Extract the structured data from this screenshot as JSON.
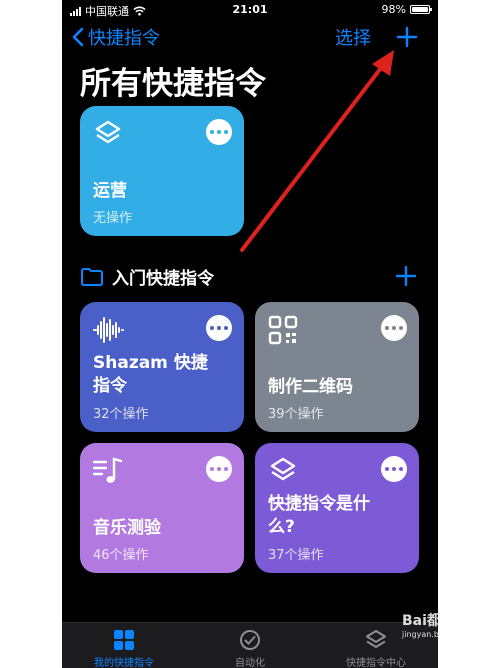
{
  "status_bar": {
    "carrier": "中国联通",
    "time": "21:01",
    "battery": "98%",
    "battery_level": 0.98
  },
  "nav": {
    "back_label": "快捷指令",
    "select_label": "选择"
  },
  "page_title": "所有快捷指令",
  "shortcuts_top": [
    {
      "name": "运营",
      "subtitle": "无操作",
      "icon": "layers-icon",
      "color": "#32ade6"
    }
  ],
  "section": {
    "title": "入门快捷指令",
    "icon": "folder-icon"
  },
  "starter_shortcuts": [
    {
      "name": "Shazam 快捷\n指令",
      "subtitle": "32个操作",
      "icon": "waveform-icon",
      "color": "#4a5fc8"
    },
    {
      "name": "制作二维码",
      "subtitle": "39个操作",
      "icon": "qrcode-icon",
      "color": "#7d8590"
    },
    {
      "name": "音乐测验",
      "subtitle": "46个操作",
      "icon": "music-icon",
      "color": "#b27ae0"
    },
    {
      "name": "快捷指令是什\n么?",
      "subtitle": "37个操作",
      "icon": "layers-icon",
      "color": "#7e5bd6"
    }
  ],
  "tabs": [
    {
      "label": "我的快捷指令",
      "icon": "grid-icon",
      "active": true
    },
    {
      "label": "自动化",
      "icon": "clock-check-icon",
      "active": false
    },
    {
      "label": "快捷指令中心",
      "icon": "layers-icon",
      "active": false
    }
  ],
  "watermark": {
    "text": "Bai都 经验",
    "url": "jingyan.baidu.com"
  },
  "colors": {
    "accent": "#0a84ff",
    "annotation_arrow": "#e0221f",
    "tab_active": "#0a84ff",
    "tab_inactive": "#8e8e93"
  }
}
